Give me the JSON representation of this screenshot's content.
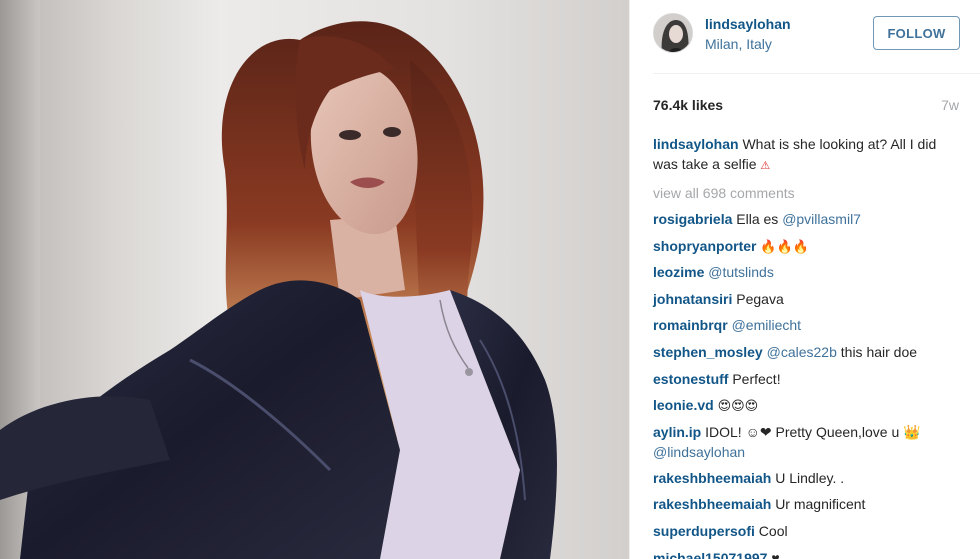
{
  "photo": {
    "alt_icon": "selfie-photo"
  },
  "post": {
    "username": "lindsaylohan",
    "location": "Milan, Italy",
    "follow_label": "FOLLOW",
    "likes": "76.4k likes",
    "age": "7w",
    "caption": {
      "user": "lindsaylohan",
      "text": "What is she looking at? All I did was take a selfie",
      "emoji": "⚠"
    },
    "view_all": "view all 698 comments"
  },
  "comments": [
    {
      "user": "rosigabriela",
      "text": "Ella es",
      "mention": "@pvillasmil7"
    },
    {
      "user": "shopryanporter",
      "text": "",
      "emoji": "🔥🔥🔥"
    },
    {
      "user": "leozime",
      "text": "",
      "mention": "@tutslinds"
    },
    {
      "user": "johnatansiri",
      "text": "Pegava"
    },
    {
      "user": "romainbrqr",
      "text": "",
      "mention": "@emiliecht"
    },
    {
      "user": "stephen_mosley",
      "text": "this hair doe",
      "mention": "@cales22b"
    },
    {
      "user": "estonestuff",
      "text": "Perfect!"
    },
    {
      "user": "leonie.vd",
      "text": "",
      "emoji": "😍😍😍"
    },
    {
      "user": "aylin.ip",
      "text": "IDOL! ☺❤ Pretty Queen,love u 👑",
      "mention": "@lindsaylohan"
    },
    {
      "user": "rakeshbheemaiah",
      "text": "U Lindley. ."
    },
    {
      "user": "rakeshbheemaiah",
      "text": "Ur magnificent"
    },
    {
      "user": "superdupersofi",
      "text": "Cool"
    },
    {
      "user": "michael15071997",
      "text": "♥"
    }
  ],
  "colors": {
    "username": "#125688",
    "link": "#3f729b",
    "muted": "#a5a7aa",
    "text": "#262626"
  }
}
